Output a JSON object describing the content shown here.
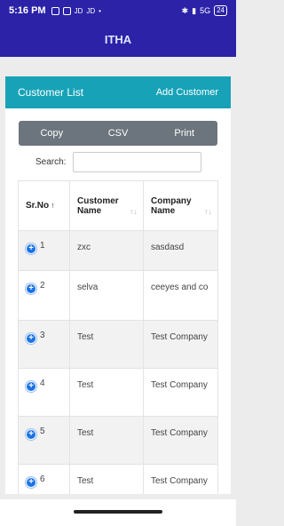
{
  "status_bar": {
    "time": "5:16 PM",
    "left_icons": [
      "JD",
      "JD"
    ],
    "network": "5G",
    "battery": "24"
  },
  "app_bar": {
    "title": "ITHA"
  },
  "card": {
    "title": "Customer List",
    "add_label": "Add Customer",
    "buttons": {
      "copy": "Copy",
      "csv": "CSV",
      "print": "Print"
    },
    "search": {
      "label": "Search:",
      "value": ""
    }
  },
  "table": {
    "headers": {
      "sr": "Sr.No",
      "customer": "Customer Name",
      "company": "Company Name"
    },
    "sort_active": "↑",
    "sort_inactive": "↑↓",
    "rows": [
      {
        "sr": "1",
        "customer": "zxc",
        "company": "sasdasd"
      },
      {
        "sr": "2",
        "customer": "selva",
        "company": "ceeyes and co"
      },
      {
        "sr": "3",
        "customer": "Test",
        "company": "Test Company"
      },
      {
        "sr": "4",
        "customer": "Test",
        "company": "Test Company"
      },
      {
        "sr": "5",
        "customer": "Test",
        "company": "Test Company"
      },
      {
        "sr": "6",
        "customer": "Test",
        "company": "Test Company"
      }
    ]
  },
  "colors": {
    "app_bar": "#2b22a8",
    "card_header": "#17a2b8",
    "button_group": "#6c757d",
    "expand_icon": "#1a73e8"
  }
}
